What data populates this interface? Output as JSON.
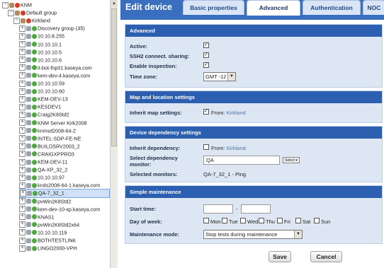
{
  "tree": {
    "items": [
      {
        "label": "KNM",
        "icon": "group-icon",
        "expander": "−"
      },
      {
        "label": "Default group",
        "icon": "group-icon",
        "expander": "−"
      },
      {
        "label": "Kirkland",
        "icon": "group-icon",
        "expander": "−"
      },
      {
        "label": "Discovery group (45)",
        "icon": "device-icon",
        "expander": "+"
      },
      {
        "label": "10.10.8.255",
        "icon": "device-icon",
        "expander": "+"
      },
      {
        "label": "10.10.10.1",
        "icon": "device-icon",
        "expander": "+"
      },
      {
        "label": "10.10.10.5",
        "icon": "device-icon",
        "expander": "+"
      },
      {
        "label": "10.10.10.6",
        "icon": "device-icon",
        "expander": "+"
      },
      {
        "label": "it-bot-fnp01.kaseya.com",
        "icon": "device-icon",
        "expander": "+"
      },
      {
        "label": "kem-dev-4.kaseya.com",
        "icon": "device-icon",
        "expander": "+"
      },
      {
        "label": "10.10.10.59",
        "icon": "device-icon",
        "expander": "+"
      },
      {
        "label": "10.10.10.60",
        "icon": "device-icon",
        "expander": "+"
      },
      {
        "label": "KEM-DEV-13",
        "icon": "device-icon",
        "expander": "+"
      },
      {
        "label": "KESDEV1",
        "icon": "device-icon",
        "expander": "+"
      },
      {
        "label": "Craig2K8Std2",
        "icon": "device-icon",
        "expander": "+"
      },
      {
        "label": "KNM Server Kirk2008",
        "icon": "device-icon",
        "expander": "+"
      },
      {
        "label": "knmsd2008-64-2",
        "icon": "device-icon",
        "expander": "+"
      },
      {
        "label": "INTEL-SDP-FE-NE",
        "icon": "device-icon",
        "expander": "+"
      },
      {
        "label": "BUILDSRV2003_2",
        "icon": "device-icon",
        "expander": "+"
      },
      {
        "label": "CRAIGXPPRO3",
        "icon": "device-icon",
        "expander": "+"
      },
      {
        "label": "KEM-DEV-11",
        "icon": "device-icon",
        "expander": "+"
      },
      {
        "label": "QA-XP_32_2",
        "icon": "device-icon",
        "expander": "+"
      },
      {
        "label": "10.10.10.97",
        "icon": "device-icon",
        "expander": "+"
      },
      {
        "label": "knds2008-64-1.kaseya.com",
        "icon": "device-icon",
        "expander": "+"
      },
      {
        "label": "QA-7_32_1",
        "icon": "device-icon",
        "expander": "+",
        "selected": true
      },
      {
        "label": "pvWin2K8Std2",
        "icon": "device-icon",
        "expander": "+"
      },
      {
        "label": "kem-dev-10-xp.kaseya.com",
        "icon": "device-icon",
        "expander": "+"
      },
      {
        "label": "KNAS1",
        "icon": "device-icon",
        "expander": "+"
      },
      {
        "label": "pvWin2K8Std2x64",
        "icon": "device-icon",
        "expander": "+"
      },
      {
        "label": "10.10.10.119",
        "icon": "device-icon",
        "expander": "+"
      },
      {
        "label": "BOTHTESTLINK",
        "icon": "device-icon",
        "expander": "+"
      },
      {
        "label": "LINGO2000-VPH",
        "icon": "device-icon",
        "expander": "+"
      }
    ]
  },
  "header": {
    "title": "Edit device",
    "tabs": [
      {
        "label": "Basic properties",
        "active": false
      },
      {
        "label": "Advanced",
        "active": true
      },
      {
        "label": "Authentication",
        "active": false
      },
      {
        "label": "NOC",
        "active": false
      }
    ]
  },
  "advanced": {
    "title": "Advanced",
    "active_label": "Active:",
    "active_checked": true,
    "ssh2_label": "SSH2 connect. sharing:",
    "ssh2_checked": true,
    "inspection_label": "Enable inspection:",
    "inspection_checked": true,
    "timezone_label": "Time zone:",
    "timezone_value": "GMT -12"
  },
  "map": {
    "title": "Map and location settings",
    "inherit_label": "Inherit map settings:",
    "inherit_checked": true,
    "from_text": "From:",
    "from_link": "Kirkland"
  },
  "dependency": {
    "title": "Device dependency settings",
    "inherit_label": "Inherit dependency:",
    "inherit_checked": false,
    "from_text": "From:",
    "from_link": "Kirkland",
    "select_label_1": "Select dependency",
    "select_label_2": "monitor:",
    "select_value": "QA",
    "select_button": "Select",
    "selected_label": "Selected monitors:",
    "selected_value": "QA-7_32_1 - Ping"
  },
  "maintenance": {
    "title": "Simple maintenance",
    "start_label": "Start time:",
    "start_sep": "-",
    "day_label": "Day of week:",
    "days": [
      "Mon",
      "Tue",
      "Wed",
      "Thu",
      "Fri",
      "Sat",
      "Sun"
    ],
    "mode_label": "Maintenance mode:",
    "mode_value": "Stop tests during maintenance"
  },
  "buttons": {
    "save": "Save",
    "cancel": "Cancel"
  },
  "colors": {
    "header_bg": "#3a6fbf",
    "section_header": "#2c5fb0",
    "section_bg": "#dde7f4",
    "link": "#3a78c9"
  }
}
